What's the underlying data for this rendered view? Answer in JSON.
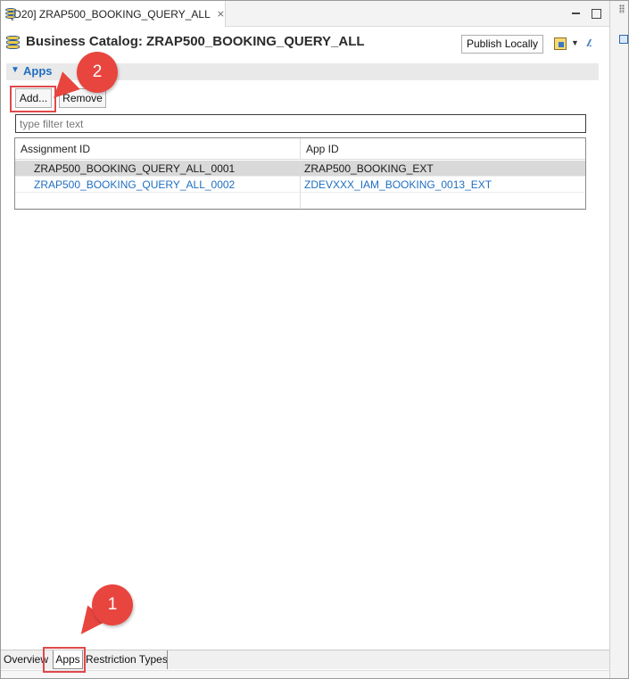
{
  "tab": {
    "label": "[D20] ZRAP500_BOOKING_QUERY_ALL",
    "close_glyph": "⨯"
  },
  "header": {
    "title": "Business Catalog: ZRAP500_BOOKING_QUERY_ALL",
    "publish_label": "Publish Locally",
    "dropdown_glyph": "▼",
    "slash_glyph": "//.."
  },
  "section": {
    "title": "Apps",
    "chevron": "▼"
  },
  "actions": {
    "add_label": "Add...",
    "remove_label": "Remove"
  },
  "filter": {
    "placeholder": "type filter text",
    "value": ""
  },
  "table": {
    "columns": [
      "Assignment ID",
      "App ID"
    ],
    "rows": [
      {
        "assignment_id": "ZRAP500_BOOKING_QUERY_ALL_0001",
        "app_id": "ZRAP500_BOOKING_EXT"
      },
      {
        "assignment_id": "ZRAP500_BOOKING_QUERY_ALL_0002",
        "app_id": "ZDEVXXX_IAM_BOOKING_0013_EXT"
      }
    ]
  },
  "bottom_tabs": [
    "Overview",
    "Apps",
    "Restriction Types"
  ],
  "annotations": {
    "marker_1": "1",
    "marker_2": "2",
    "color": "#e8453f"
  }
}
